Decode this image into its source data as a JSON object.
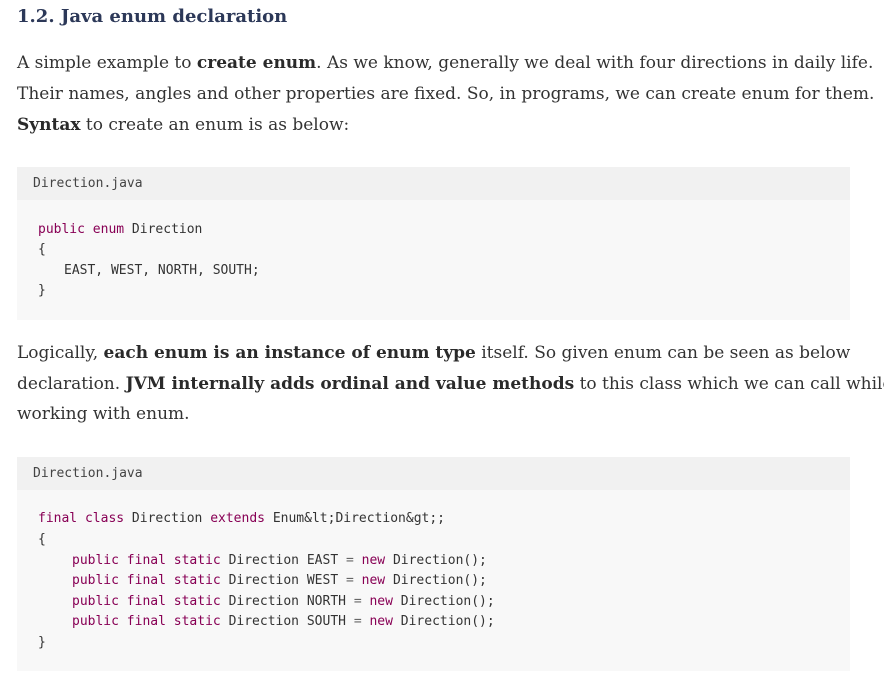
{
  "section": {
    "heading": "1.2. Java enum declaration"
  },
  "intro": {
    "l1_a": "A simple example to ",
    "l1_b": "create enum",
    "l1_c": ". As we know, generally we deal with four directions in daily life.",
    "l2": "Their names, angles and other properties are fixed. So, in programs, we can create enum for them.",
    "l3_a": "Syntax",
    "l3_b": " to create an enum is as below:"
  },
  "code1": {
    "filename": "Direction.java",
    "kw_public": "public",
    "kw_enum": "enum",
    "name": " Direction",
    "open_brace": "{",
    "values": "EAST, WEST, NORTH, SOUTH;",
    "close_brace": "}"
  },
  "logic": {
    "l1_a": "Logically, ",
    "l1_b": "each enum is an instance of enum type",
    "l1_c": " itself. So given enum can be seen as below",
    "l2_a": "declaration. ",
    "l2_b": "JVM internally adds ordinal and value methods",
    "l2_c": " to this class which we can call while",
    "l3": "working with enum."
  },
  "code2": {
    "filename": "Direction.java",
    "kw_final": "final",
    "kw_class": "class",
    "name": " Direction ",
    "kw_extends": "extends",
    "super": " Enum&lt;Direction&gt;;",
    "open_brace": "{",
    "close_brace": "}",
    "kw_public": "public",
    "kw_final2": "final",
    "kw_static": "static",
    "type": "Direction",
    "kw_new": "new",
    "ctor": " Direction();",
    "eq": "=",
    "fields": [
      "EAST",
      "WEST",
      "NORTH",
      "SOUTH"
    ]
  }
}
